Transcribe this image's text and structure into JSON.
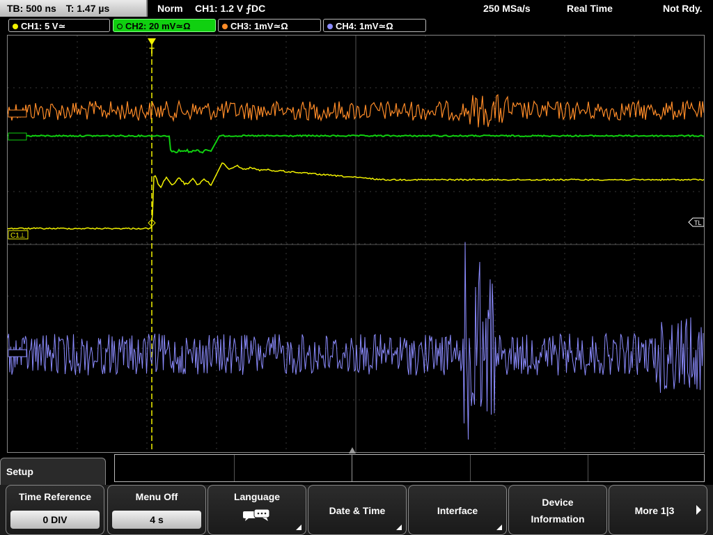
{
  "status": {
    "timebase": "TB: 500 ns",
    "trigger_time": "T: 1.47 µs",
    "mode": "Norm",
    "trigger_setting": "CH1: 1.2 V ⨍DC",
    "sample_rate": "250 MSa/s",
    "acquire_mode": "Real Time",
    "state": "Not Rdy."
  },
  "channels": [
    {
      "label": "CH1: 5 V≃",
      "color": "#f2f200"
    },
    {
      "label": "CH2: 20 mV≃Ω",
      "color": "#10d010"
    },
    {
      "label": "CH3: 1mV≃Ω",
      "color": "#ff8c28"
    },
    {
      "label": "CH4: 1mV≃Ω",
      "color": "#8c8cff"
    }
  ],
  "markers": {
    "trigger_marker": "T",
    "ch1_ref": "C1⊥",
    "trigger_level": "TL"
  },
  "menu": {
    "title": "Setup",
    "softkeys": [
      {
        "label": "Time Reference",
        "value": "0 DIV"
      },
      {
        "label": "Menu Off",
        "value": "4 s"
      },
      {
        "label": "Language",
        "icon": "speech-bubbles-icon"
      },
      {
        "label": "Date & Time"
      },
      {
        "label": "Interface"
      },
      {
        "label": "Device",
        "label2": "Information"
      },
      {
        "label": "More 1|3"
      }
    ]
  }
}
